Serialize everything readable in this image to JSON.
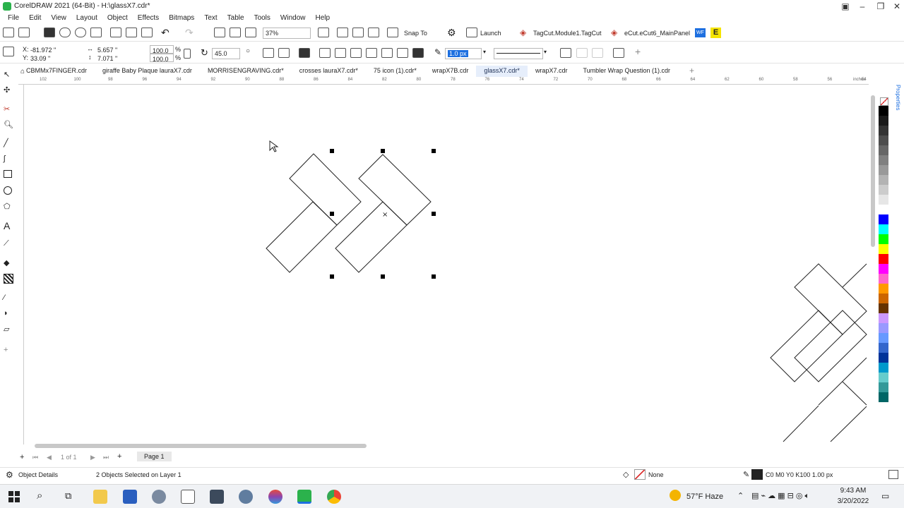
{
  "window": {
    "title": "CorelDRAW 2021 (64-Bit) - H:\\glassX7.cdr*"
  },
  "menu": [
    "File",
    "Edit",
    "View",
    "Layout",
    "Object",
    "Effects",
    "Bitmaps",
    "Text",
    "Table",
    "Tools",
    "Window",
    "Help"
  ],
  "toolbar1": {
    "zoom": "37%",
    "snap_to": "Snap To",
    "launch": "Launch",
    "plugin1": "TagCut.Module1.TagCut",
    "plugin2": "eCut.eCut6_MainPanel",
    "wf_badge": "WF",
    "e_badge": "E"
  },
  "toolbar2": {
    "x": "-81.972 \"",
    "y": "33.09 \"",
    "width": "5.657 \"",
    "height": "7.071 \"",
    "scale_x": "100.0",
    "scale_y": "100.0",
    "pct": "%",
    "angle": "45.0",
    "outline_width": "1.0 px"
  },
  "tabs": [
    "CBMMx7FINGER.cdr",
    "giraffe Baby Plaque lauraX7.cdr",
    "MORRISENGRAVING.cdr*",
    "crosses lauraX7.cdr*",
    "75 icon (1).cdr*",
    "wrapX7B.cdr",
    "glassX7.cdr*",
    "wrapX7.cdr",
    "Tumbler Wrap Question (1).cdr"
  ],
  "active_tab_index": 6,
  "ruler": {
    "ticks": [
      "102",
      "100",
      "98",
      "96",
      "94",
      "92",
      "90",
      "88",
      "86",
      "84",
      "82",
      "80",
      "78",
      "76",
      "74",
      "72",
      "70",
      "68",
      "66",
      "64",
      "62",
      "60",
      "58",
      "56",
      "54"
    ],
    "unit": "inches"
  },
  "pagebar": {
    "page_count": "1 of 1",
    "page_tab": "Page 1"
  },
  "status": {
    "object_details": "Object Details",
    "selection": "2 Objects Selected on Layer 1",
    "fill": "None",
    "outline": "C0 M0 Y0 K100  1.00 px"
  },
  "taskbar": {
    "weather": "57°F  Haze",
    "time": "9:43 AM",
    "date": "3/20/2022"
  },
  "colors": {
    "accent": "#1d6fe0",
    "palette": [
      "#000000",
      "#1a1a1a",
      "#333333",
      "#4d4d4d",
      "#666666",
      "#808080",
      "#999999",
      "#b3b3b3",
      "#cccccc",
      "#e6e6e6",
      "#ffffff",
      "#0000ff",
      "#00ffff",
      "#00ff00",
      "#ffff00",
      "#ff0000",
      "#ff00ff",
      "#ff66cc",
      "#ff9900",
      "#cc6600",
      "#663300",
      "#cc99ff",
      "#9999ff",
      "#6699ff",
      "#3366cc",
      "#003399",
      "#0099cc",
      "#66cccc",
      "#339999",
      "#006666"
    ]
  }
}
